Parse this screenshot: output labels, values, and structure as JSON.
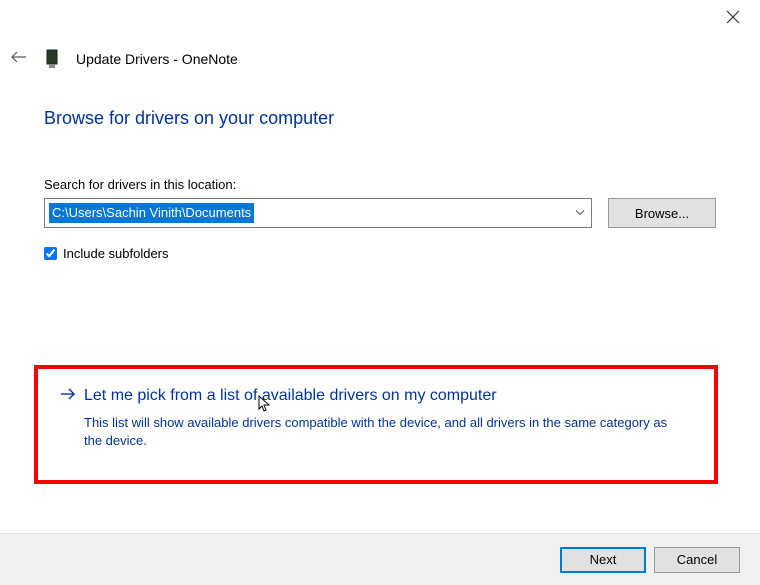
{
  "window": {
    "title": "Update Drivers - OneNote"
  },
  "page": {
    "heading": "Browse for drivers on your computer",
    "search_label": "Search for drivers in this location:",
    "path_value": "C:\\Users\\Sachin Vinith\\Documents",
    "browse_label": "Browse...",
    "include_subfolders_label": "Include subfolders",
    "include_subfolders_checked": true
  },
  "option": {
    "title": "Let me pick from a list of available drivers on my computer",
    "description": "This list will show available drivers compatible with the device, and all drivers in the same category as the device."
  },
  "footer": {
    "next_label": "Next",
    "cancel_label": "Cancel"
  },
  "colors": {
    "accent": "#003399",
    "highlight_border": "#ff0000",
    "selection_bg": "#0078d7"
  }
}
